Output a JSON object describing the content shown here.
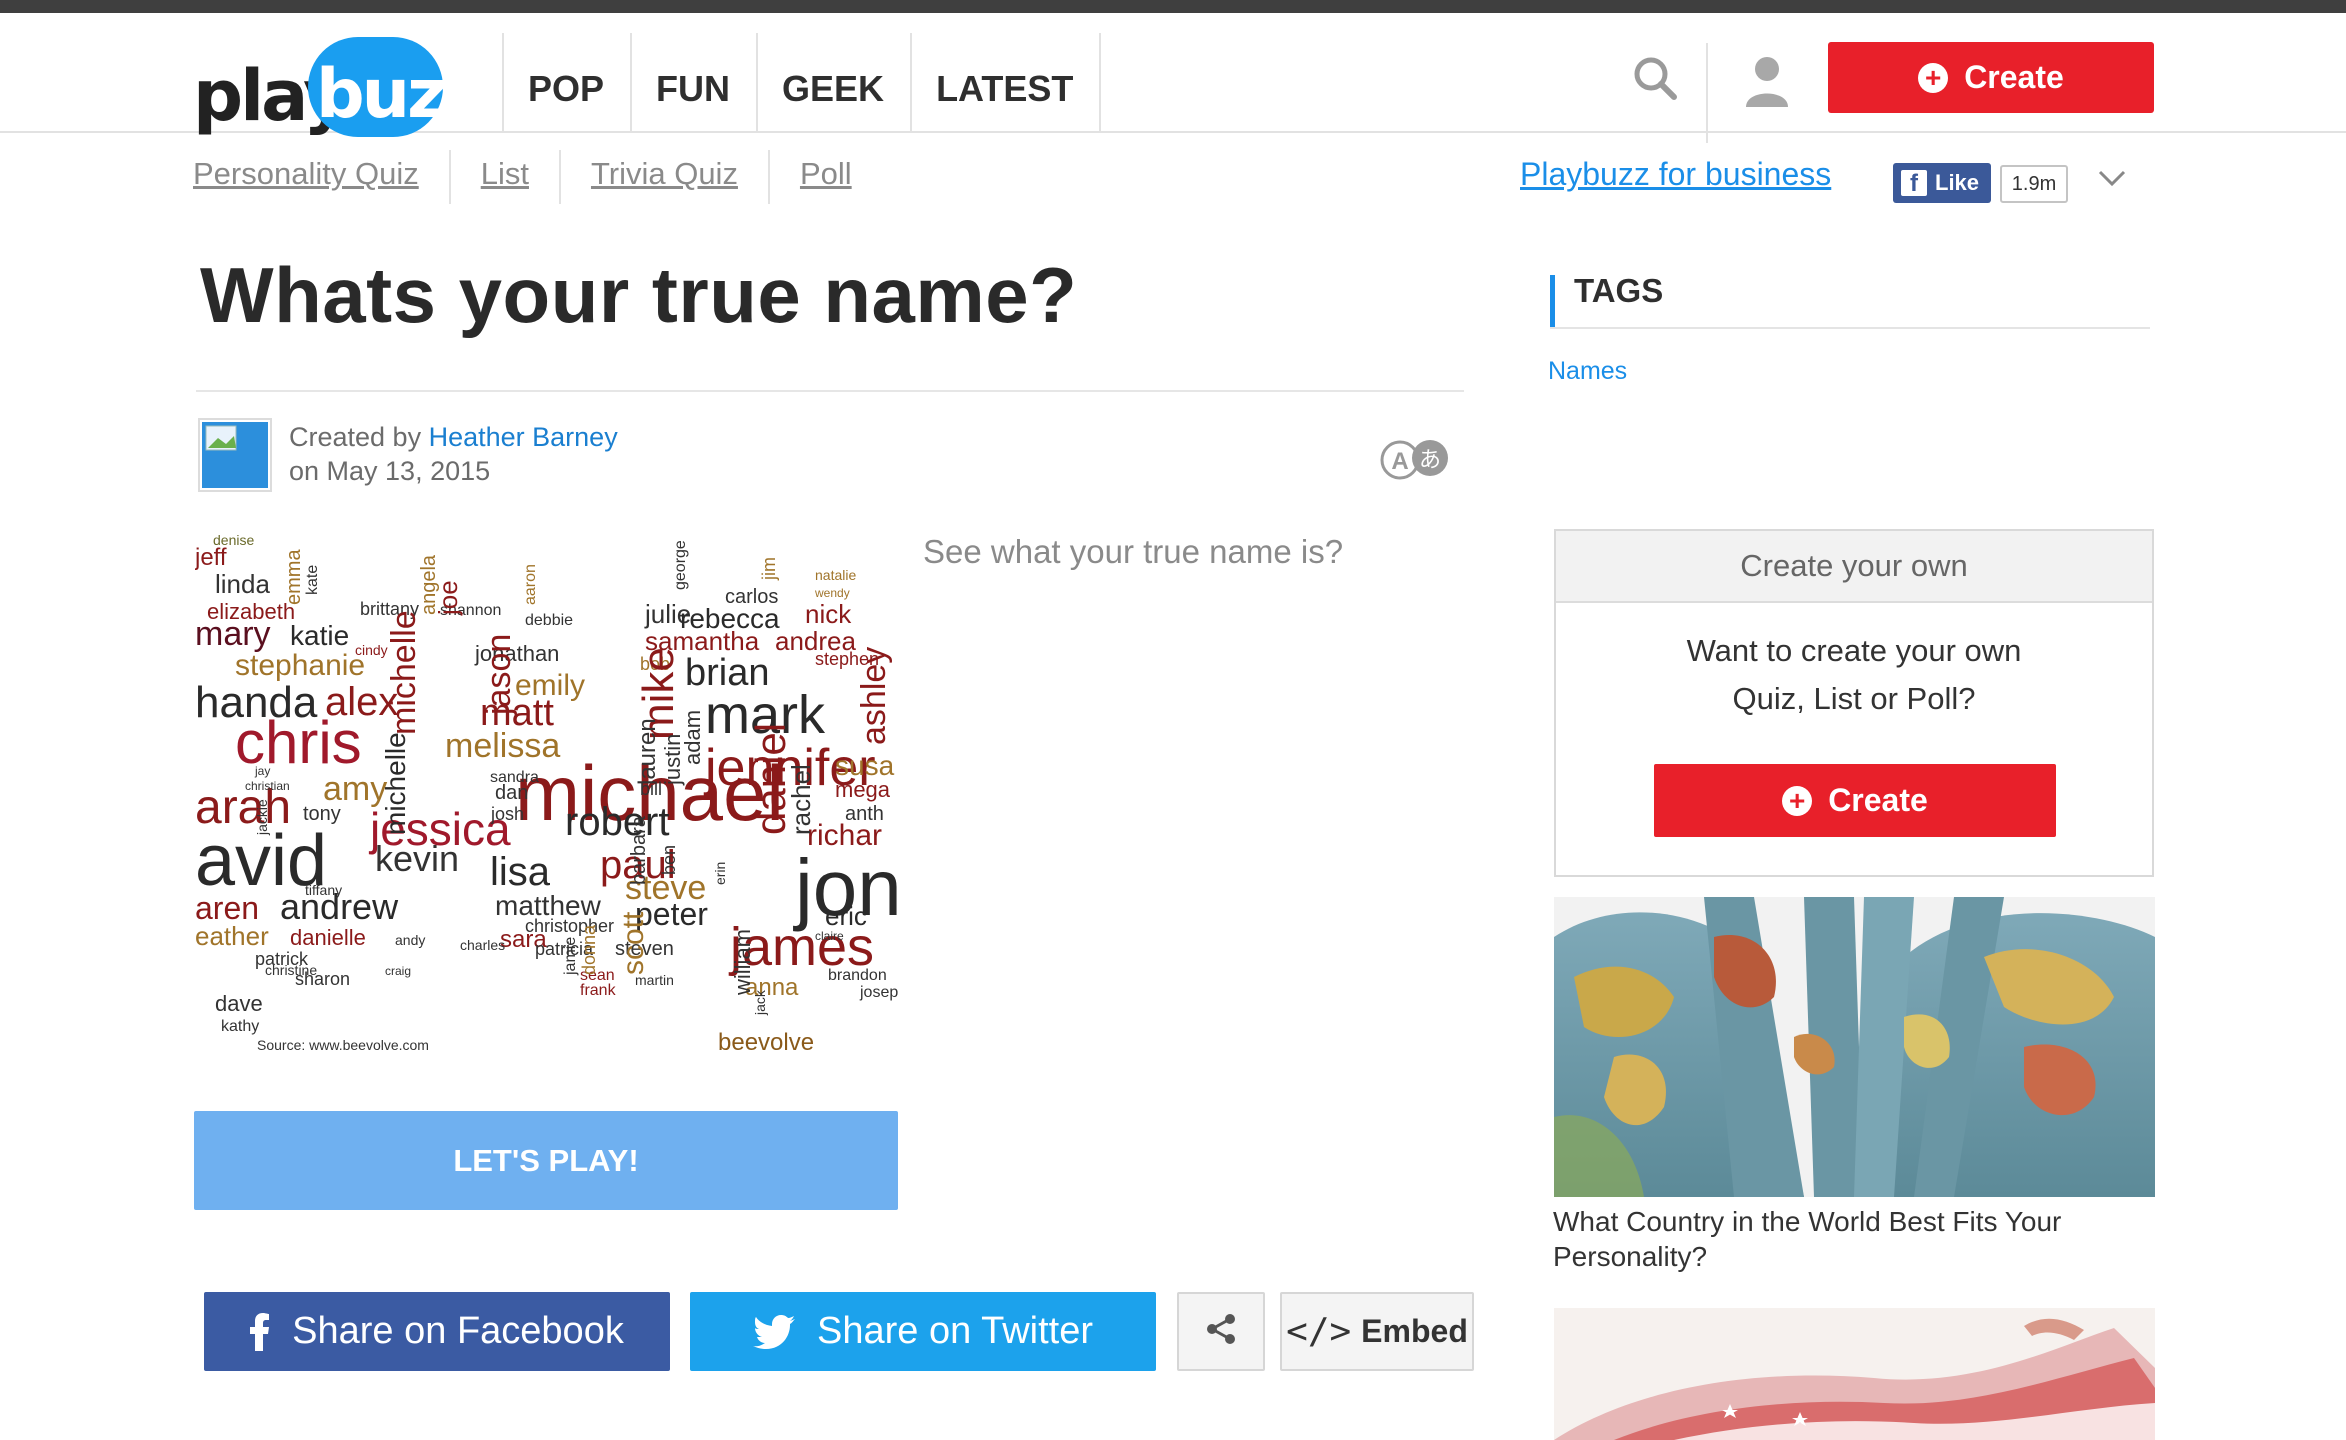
{
  "header": {
    "logo_play": "play",
    "logo_buzz": "buzz",
    "nav": [
      "POP",
      "FUN",
      "GEEK",
      "LATEST"
    ],
    "create_label": "Create"
  },
  "subnav": {
    "items": [
      "Personality Quiz",
      "List",
      "Trivia Quiz",
      "Poll"
    ],
    "business_link": "Playbuzz for business",
    "fb_like_label": "Like",
    "fb_like_count": "1.9m"
  },
  "article": {
    "title": "Whats your true name?",
    "created_by_label": "Created by",
    "author": "Heather Barney",
    "date": "on May 13, 2015",
    "description": "See what your true name is?",
    "play_label": "LET'S PLAY!",
    "image": {
      "source": "Source: www.beevolve.com",
      "brand": "beevolve"
    }
  },
  "share": {
    "facebook": "Share on Facebook",
    "twitter": "Share on Twitter",
    "embed": "Embed"
  },
  "sidebar": {
    "tags_heading": "TAGS",
    "tags": [
      "Names"
    ],
    "create_box": {
      "heading": "Create your own",
      "text_line1": "Want to create your own",
      "text_line2": "Quiz, List or Poll?",
      "button": "Create"
    },
    "related": [
      {
        "caption": "What Country in the World Best Fits Your Personality?"
      }
    ]
  },
  "colors": {
    "brand_blue": "#1a9ef0",
    "create_red": "#e8202a",
    "play_blue": "#6fb0f0",
    "facebook": "#3b5ba3",
    "twitter": "#1ca2ec",
    "link_blue": "#1a8ee8"
  }
}
